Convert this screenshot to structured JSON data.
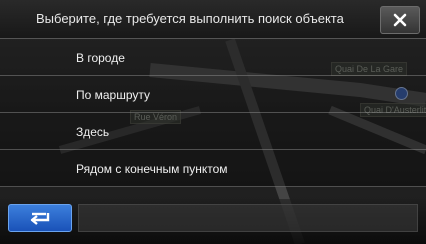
{
  "dialog": {
    "title": "Выберите, где требуется выполнить поиск объекта",
    "close_icon": "close-icon"
  },
  "menu": {
    "items": [
      {
        "label": "В городе"
      },
      {
        "label": "По маршруту"
      },
      {
        "label": "Здесь"
      },
      {
        "label": "Рядом с конечным пунктом"
      }
    ]
  },
  "bottom_bar": {
    "back_icon": "back-arrow-icon"
  },
  "map": {
    "street_labels": [
      "Quai De La Gare",
      "Rue Véron",
      "Quai D'Austerlitz"
    ]
  },
  "colors": {
    "accent_blue": "#2a66cc",
    "text": "#f0f0f0",
    "divider": "#969696"
  }
}
